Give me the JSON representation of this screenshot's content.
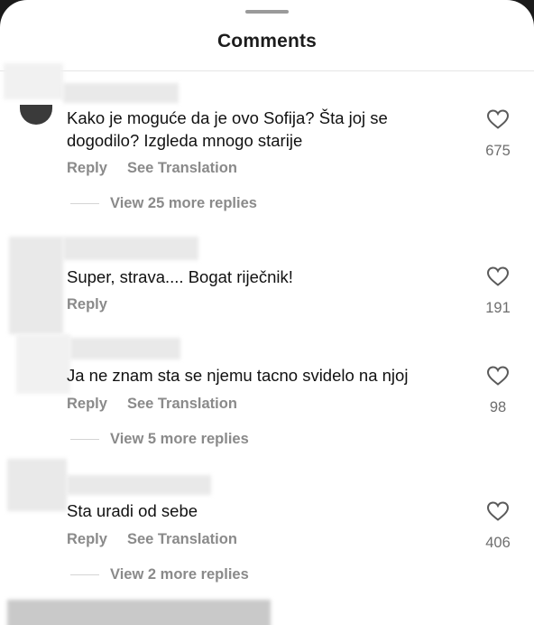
{
  "header": {
    "title": "Comments"
  },
  "comments": [
    {
      "text": "Kako je moguće da je ovo Sofija? Šta joj se dogodilo? Izgleda mnogo starije",
      "reply_label": "Reply",
      "translation_label": "See Translation",
      "likes": "675",
      "view_replies": "View 25 more replies"
    },
    {
      "text": "Super, strava.... Bogat riječnik!",
      "reply_label": "Reply",
      "likes": "191"
    },
    {
      "text": "Ja ne znam sta se njemu tacno svidelo na njoj",
      "reply_label": "Reply",
      "translation_label": "See Translation",
      "likes": "98",
      "view_replies": "View 5 more replies"
    },
    {
      "text": "Sta uradi od sebe",
      "reply_label": "Reply",
      "translation_label": "See Translation",
      "likes": "406",
      "view_replies": "View 2 more replies"
    }
  ],
  "icons": {
    "like": "heart-outline-icon"
  },
  "colors": {
    "background": "#ffffff",
    "text": "#111111",
    "secondary_text": "#8a8a8a",
    "like_count": "#6e6e6e"
  }
}
